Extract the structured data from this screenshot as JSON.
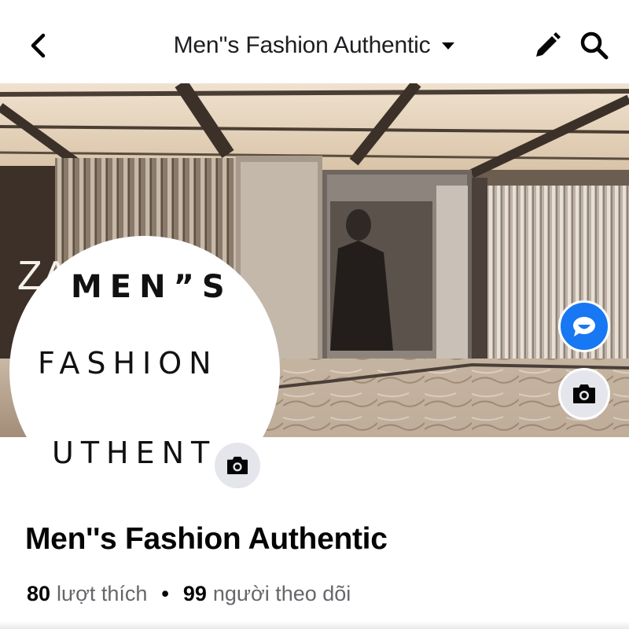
{
  "header": {
    "title": "Men''s Fashion Authentic"
  },
  "avatar": {
    "line1": "MEN”S",
    "line2": "FASHION",
    "line3": "UTHENT"
  },
  "cover": {
    "store_sign": "ZA"
  },
  "page": {
    "name": "Men''s Fashion Authentic",
    "likes_count": "80",
    "likes_label": "lượt thích",
    "separator": "•",
    "followers_count": "99",
    "followers_label": "người theo dõi"
  },
  "icons": {
    "back": "chevron-left-icon",
    "dropdown": "caret-down-icon",
    "edit": "pencil-icon",
    "search": "search-icon",
    "messenger": "messenger-icon",
    "camera": "camera-icon"
  },
  "colors": {
    "accent": "#1877f2",
    "text": "#050505",
    "secondary_text": "#65676b",
    "button_gray": "#e4e6eb"
  }
}
